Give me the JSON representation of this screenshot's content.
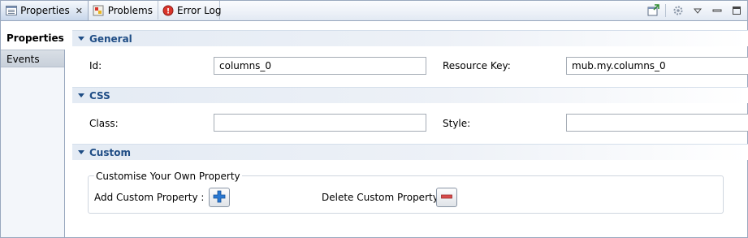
{
  "tabs": [
    {
      "label": "Properties",
      "icon": "properties-view-icon",
      "active": true
    },
    {
      "label": "Problems",
      "icon": "problems-icon",
      "active": false
    },
    {
      "label": "Error Log",
      "icon": "error-log-icon",
      "active": false
    }
  ],
  "sidebar": {
    "items": [
      {
        "label": "Properties",
        "active": true
      },
      {
        "label": "Events",
        "active": false
      }
    ]
  },
  "sections": {
    "general": {
      "title": "General",
      "id_label": "Id:",
      "id_value": "columns_0",
      "resource_key_label": "Resource Key:",
      "resource_key_value": "mub.my.columns_0"
    },
    "css": {
      "title": "CSS",
      "class_label": "Class:",
      "class_value": "",
      "style_label": "Style:",
      "style_value": ""
    },
    "custom": {
      "title": "Custom",
      "group_title": "Customise Your Own Property",
      "add_label": "Add Custom Property :",
      "delete_label": "Delete Custom Property :"
    }
  },
  "colors": {
    "section_title": "#1f4d85",
    "add_icon": "#2a78d1",
    "delete_icon": "#d84b4b"
  }
}
